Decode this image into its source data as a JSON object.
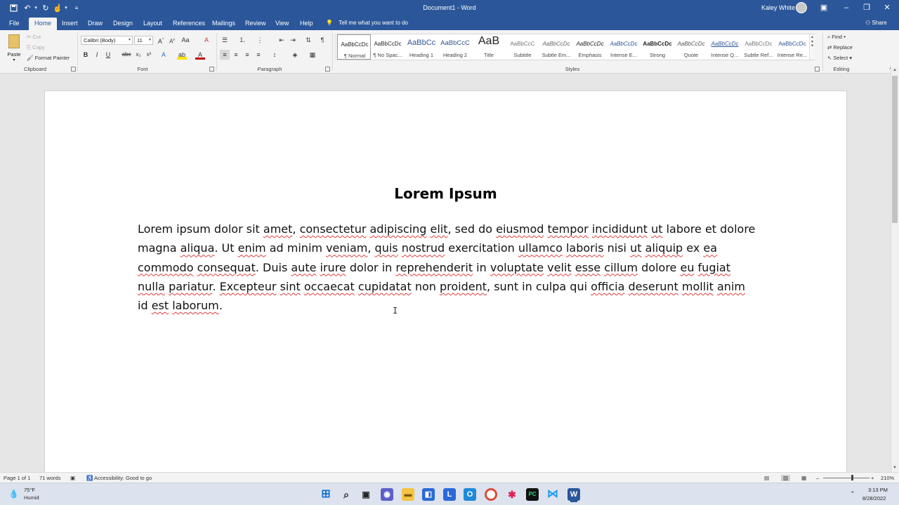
{
  "titlebar": {
    "doc_title": "Document1  -  Word",
    "user_name": "Kaley White"
  },
  "tabs": [
    "File",
    "Home",
    "Insert",
    "Draw",
    "Design",
    "Layout",
    "References",
    "Mailings",
    "Review",
    "View",
    "Help"
  ],
  "tell_me": "Tell me what you want to do",
  "share": "Share",
  "ribbon": {
    "clipboard": {
      "paste": "Paste",
      "cut": "Cut",
      "copy": "Copy",
      "format_painter": "Format Painter",
      "label": "Clipboard"
    },
    "font": {
      "name": "Calibri (Body)",
      "size": "11",
      "label": "Font"
    },
    "paragraph": {
      "label": "Paragraph"
    },
    "styles": {
      "label": "Styles",
      "items": [
        {
          "preview": "AaBbCcDc",
          "name": "¶ Normal"
        },
        {
          "preview": "AaBbCcDc",
          "name": "¶ No Spac..."
        },
        {
          "preview": "AaBbCc",
          "name": "Heading 1"
        },
        {
          "preview": "AaBbCcC",
          "name": "Heading 2"
        },
        {
          "preview": "AaB",
          "name": "Title"
        },
        {
          "preview": "AaBbCcC",
          "name": "Subtitle"
        },
        {
          "preview": "AaBbCcDc",
          "name": "Subtle Em..."
        },
        {
          "preview": "AaBbCcDc",
          "name": "Emphasis"
        },
        {
          "preview": "AaBbCcDc",
          "name": "Intense E..."
        },
        {
          "preview": "AaBbCcDc",
          "name": "Strong"
        },
        {
          "preview": "AaBbCcDc",
          "name": "Quote"
        },
        {
          "preview": "AaBbCcDc",
          "name": "Intense Q..."
        },
        {
          "preview": "AaBbCcDc",
          "name": "Subtle Ref..."
        },
        {
          "preview": "AaBbCcDc",
          "name": "Intense Re..."
        }
      ]
    },
    "editing": {
      "find": "Find",
      "replace": "Replace",
      "select": "Select",
      "label": "Editing"
    }
  },
  "document": {
    "heading": "Lorem Ipsum"
  },
  "statusbar": {
    "page": "Page 1 of 1",
    "words": "71 words",
    "accessibility": "Accessibility: Good to go",
    "zoom": "210%"
  },
  "taskbar": {
    "temperature": "75°F",
    "weather": "Humid",
    "time": "3:13 PM",
    "date": "8/28/2022"
  },
  "colors": {
    "word_blue": "#2b579a",
    "ribbon_bg": "#f3f3f3",
    "spell_error": "#e23b3b"
  },
  "icons": [
    "save-icon",
    "undo-icon",
    "redo-icon",
    "touch-icon",
    "lightbulb-icon",
    "search-icon",
    "windows-start-icon",
    "word-icon",
    "vscode-icon",
    "chrome-icon"
  ]
}
